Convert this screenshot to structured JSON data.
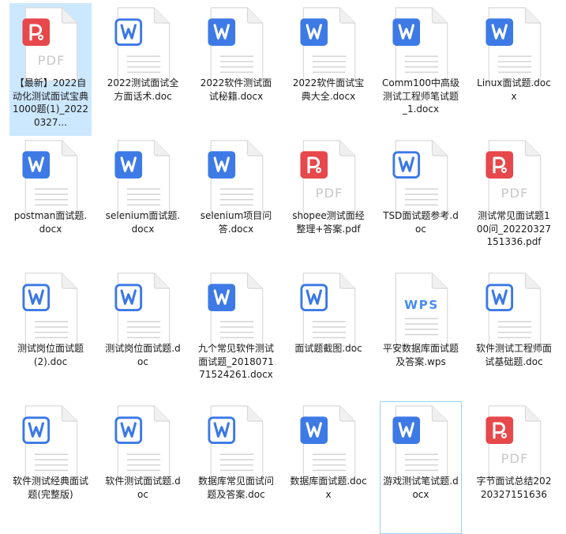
{
  "colors": {
    "word": "#3d7ae6",
    "word_hollow": "#3b78e7",
    "pdf": "#e6484b",
    "wps": "#4a8cf0",
    "selection": "#cce8ff",
    "hover_border": "#99d1ff"
  },
  "files": [
    {
      "name": "【最新】2022自动化测试面试宝典1000题(1)_20220327...",
      "type": "pdf",
      "icon": "pdf-file-icon",
      "pdf_text": "PDF",
      "selected": true
    },
    {
      "name": "2022测试面试全方面话术.doc",
      "type": "word-hollow",
      "icon": "word-doc-icon"
    },
    {
      "name": "2022软件测试面试秘籍.docx",
      "type": "word",
      "icon": "word-docx-icon"
    },
    {
      "name": "2022软件面试宝典大全.docx",
      "type": "word",
      "icon": "word-docx-icon"
    },
    {
      "name": "Comm100中高级测试工程师笔试题_1.docx",
      "type": "word",
      "icon": "word-docx-icon"
    },
    {
      "name": "Linux面试题.docx",
      "type": "word",
      "icon": "word-docx-icon"
    },
    {
      "name": "postman面试题.docx",
      "type": "word",
      "icon": "word-docx-icon"
    },
    {
      "name": "selenium面试题.docx",
      "type": "word",
      "icon": "word-docx-icon"
    },
    {
      "name": "selenium项目问答.docx",
      "type": "word",
      "icon": "word-docx-icon"
    },
    {
      "name": "shopee测试面经整理+答案.pdf",
      "type": "pdf",
      "icon": "pdf-file-icon",
      "pdf_text": "PDF"
    },
    {
      "name": "TSD面试题参考.doc",
      "type": "word-hollow",
      "icon": "word-doc-icon"
    },
    {
      "name": "测试常见面试题100问_20220327151336.pdf",
      "type": "pdf",
      "icon": "pdf-file-icon",
      "pdf_text": "PDF"
    },
    {
      "name": "测试岗位面试题(2).doc",
      "type": "word-hollow",
      "icon": "word-doc-icon"
    },
    {
      "name": "测试岗位面试题.doc",
      "type": "word-hollow",
      "icon": "word-doc-icon"
    },
    {
      "name": "九个常见软件测试面试题_201807171524261.docx",
      "type": "word",
      "icon": "word-docx-icon"
    },
    {
      "name": "面试题截图.doc",
      "type": "word-hollow",
      "icon": "word-doc-icon"
    },
    {
      "name": "平安数据库面试题及答案.wps",
      "type": "wps",
      "icon": "wps-file-icon",
      "wps_text": "WPS"
    },
    {
      "name": "软件测试工程师面试基础题.doc",
      "type": "word-hollow",
      "icon": "word-doc-icon"
    },
    {
      "name": "软件测试经典面试题(完整版)",
      "type": "word-hollow",
      "icon": "word-doc-icon"
    },
    {
      "name": "软件测试面试题.doc",
      "type": "word-hollow",
      "icon": "word-doc-icon"
    },
    {
      "name": "数据库常见面试问题及答案.doc",
      "type": "word-hollow",
      "icon": "word-doc-icon"
    },
    {
      "name": "数据库面试题.docx",
      "type": "word",
      "icon": "word-docx-icon"
    },
    {
      "name": "游戏测试笔试题.docx",
      "type": "word",
      "icon": "word-docx-icon",
      "hovered": true
    },
    {
      "name": "字节面试总结20220327151636",
      "type": "pdf",
      "icon": "pdf-file-icon",
      "pdf_text": "PDF"
    }
  ]
}
